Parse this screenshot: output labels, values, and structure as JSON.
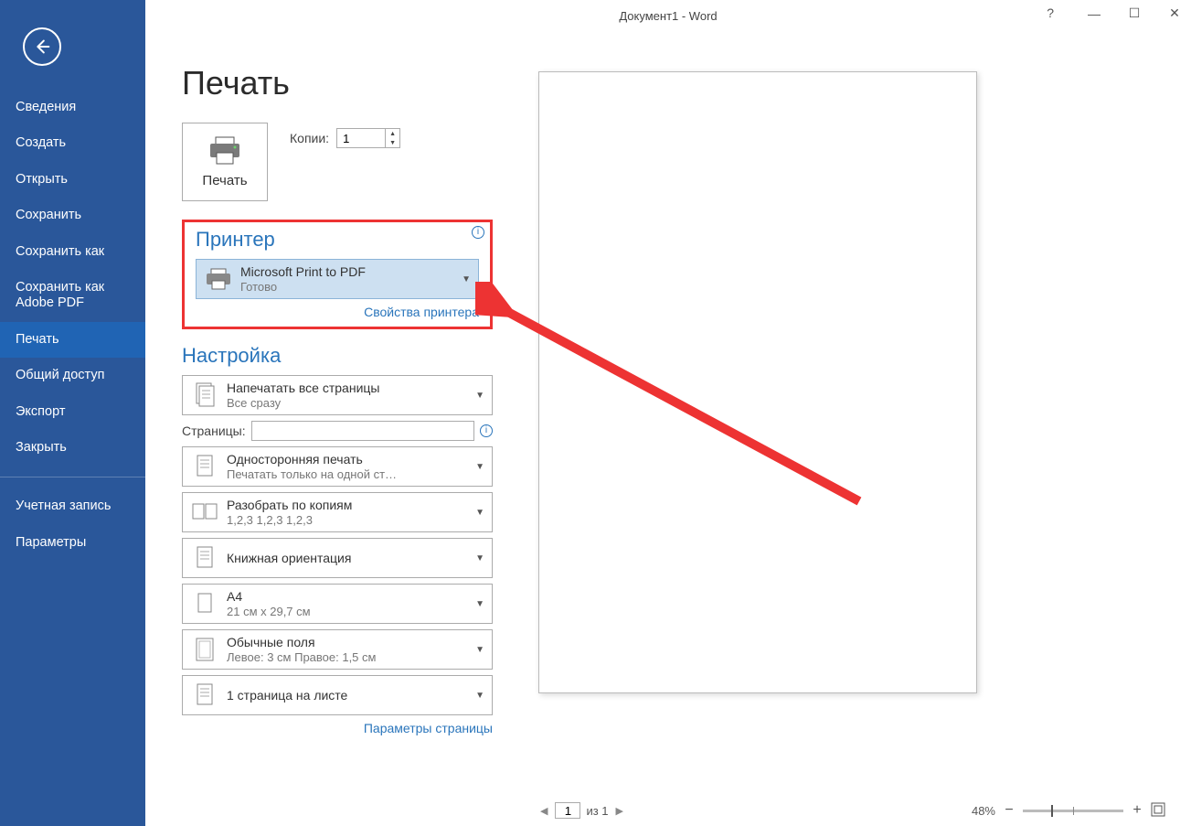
{
  "titlebar": {
    "title": "Документ1 - Word"
  },
  "sidebar": {
    "items": [
      "Сведения",
      "Создать",
      "Открыть",
      "Сохранить",
      "Сохранить как",
      "Сохранить как Adobe PDF",
      "Печать",
      "Общий доступ",
      "Экспорт",
      "Закрыть"
    ],
    "bottom": [
      "Учетная запись",
      "Параметры"
    ],
    "active_index": 6
  },
  "page": {
    "title": "Печать",
    "print_button": "Печать",
    "copies_label": "Копии:",
    "copies_value": "1"
  },
  "printer": {
    "section": "Принтер",
    "name": "Microsoft Print to PDF",
    "status": "Готово",
    "properties_link": "Свойства принтера"
  },
  "settings": {
    "section": "Настройка",
    "print_what": {
      "title": "Напечатать все страницы",
      "sub": "Все сразу"
    },
    "pages_label": "Страницы:",
    "pages_value": "",
    "sides": {
      "title": "Односторонняя печать",
      "sub": "Печатать только на одной ст…"
    },
    "collate": {
      "title": "Разобрать по копиям",
      "sub": "1,2,3    1,2,3    1,2,3"
    },
    "orientation": {
      "title": "Книжная ориентация",
      "sub": ""
    },
    "paper": {
      "title": "A4",
      "sub": "21 см x 29,7 см"
    },
    "margins": {
      "title": "Обычные поля",
      "sub": "Левое: 3 см    Правое: 1,5 см"
    },
    "per_sheet": {
      "title": "1 страница на листе",
      "sub": ""
    },
    "page_setup_link": "Параметры страницы"
  },
  "preview_footer": {
    "current": "1",
    "of_label": "из 1",
    "zoom": "48%"
  }
}
